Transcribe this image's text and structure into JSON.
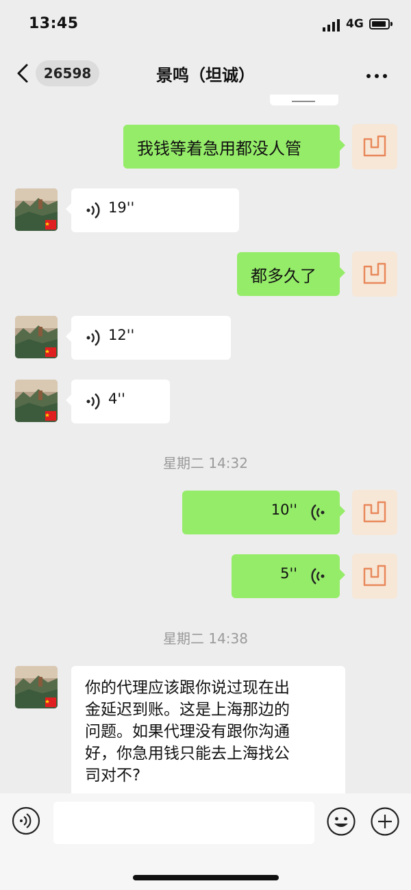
{
  "status": {
    "time": "13:45",
    "network": "4G"
  },
  "nav": {
    "back_count": "26598",
    "title": "景鸣（坦诚）"
  },
  "messages": [
    {
      "side": "out",
      "type": "text",
      "text": "我钱等着急用都没人管"
    },
    {
      "side": "in",
      "type": "voice",
      "duration": "19''"
    },
    {
      "side": "out",
      "type": "text",
      "text": "都多久了"
    },
    {
      "side": "in",
      "type": "voice",
      "duration": "12''"
    },
    {
      "side": "in",
      "type": "voice",
      "duration": "4''"
    },
    {
      "type": "timestamp",
      "text": "星期二 14:32"
    },
    {
      "side": "out",
      "type": "voice",
      "duration": "10''"
    },
    {
      "side": "out",
      "type": "voice",
      "duration": "5''"
    },
    {
      "type": "timestamp",
      "text": "星期二 14:38"
    },
    {
      "side": "in",
      "type": "text",
      "lines": [
        "你的代理应该跟你说过现在出",
        "金延迟到账。这是上海那边的",
        "问题。如果代理没有跟你沟通",
        "好，你急用钱只能去上海找公",
        "司对不?"
      ]
    }
  ],
  "colors": {
    "out_bubble": "#95ec69",
    "in_bubble": "#ffffff",
    "background": "#ededed"
  },
  "icons": {
    "back": "chevron-left-icon",
    "more": "more-dots-icon",
    "voice_mode": "voice-mode-icon",
    "emoji": "smiley-icon",
    "add": "plus-icon"
  }
}
